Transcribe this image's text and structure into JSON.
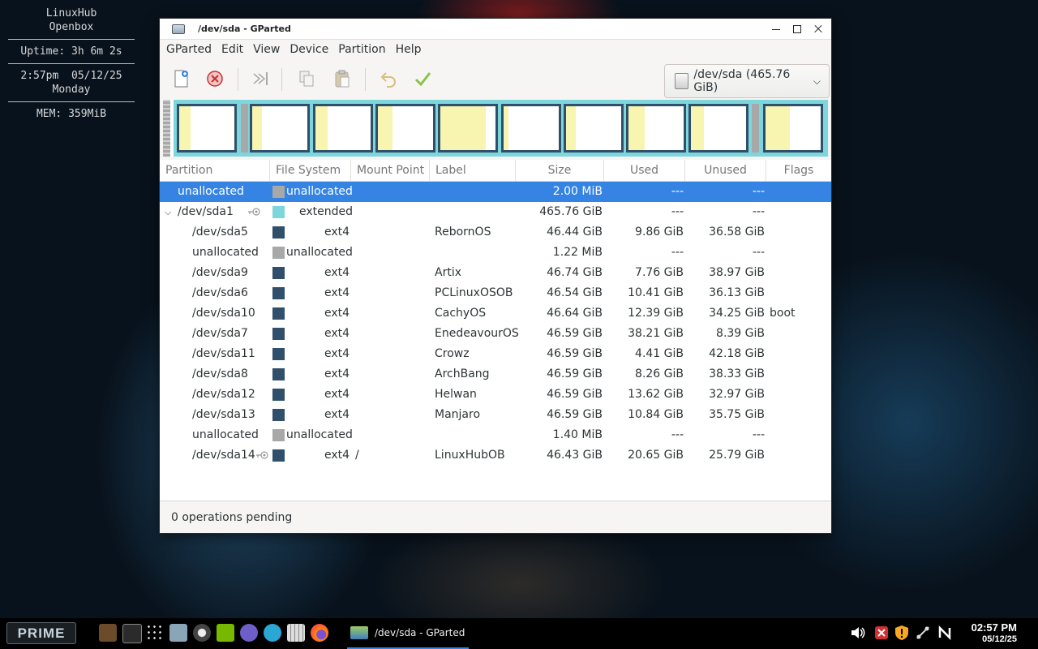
{
  "conky": {
    "hostname": "LinuxHub",
    "wm": "Openbox",
    "uptime": "Uptime: 3h 6m 2s",
    "time_date": "2:57pm  05/12/25",
    "weekday": "Monday",
    "mem": "MEM: 359MiB"
  },
  "window": {
    "title": "/dev/sda - GParted",
    "icon": "gparted-app-icon"
  },
  "menubar": [
    "GParted",
    "Edit",
    "View",
    "Device",
    "Partition",
    "Help"
  ],
  "toolbar": {
    "buttons": [
      "new-icon",
      "delete-icon",
      "resize-move-icon",
      "copy-icon",
      "paste-icon",
      "undo-icon",
      "apply-icon"
    ],
    "device_selector": "/dev/sda (465.76 GiB)"
  },
  "colors": {
    "unallocated": "#a8a8a8",
    "extended": "#7ed6dd",
    "ext4": "#2f4f6a",
    "used_fill": "#f7f5b0",
    "selection": "#3584e4"
  },
  "table": {
    "columns": [
      "Partition",
      "File System",
      "Mount Point",
      "Label",
      "Size",
      "Used",
      "Unused",
      "Flags"
    ],
    "rows": [
      {
        "partition": "unallocated",
        "fs": "unallocated",
        "mount": "",
        "label": "",
        "size": "2.00 MiB",
        "used": "---",
        "unused": "---",
        "flags": "",
        "level": 0,
        "selected": true
      },
      {
        "partition": "/dev/sda1",
        "fs": "extended",
        "mount": "",
        "label": "",
        "size": "465.76 GiB",
        "used": "---",
        "unused": "---",
        "flags": "",
        "level": 0,
        "expanded": true,
        "key": true
      },
      {
        "partition": "/dev/sda5",
        "fs": "ext4",
        "mount": "",
        "label": "RebornOS",
        "size": "46.44 GiB",
        "used": "9.86 GiB",
        "unused": "36.58 GiB",
        "flags": "",
        "level": 1
      },
      {
        "partition": "unallocated",
        "fs": "unallocated",
        "mount": "",
        "label": "",
        "size": "1.22 MiB",
        "used": "---",
        "unused": "---",
        "flags": "",
        "level": 1
      },
      {
        "partition": "/dev/sda9",
        "fs": "ext4",
        "mount": "",
        "label": "Artix",
        "size": "46.74 GiB",
        "used": "7.76 GiB",
        "unused": "38.97 GiB",
        "flags": "",
        "level": 1
      },
      {
        "partition": "/dev/sda6",
        "fs": "ext4",
        "mount": "",
        "label": "PCLinuxOSOB",
        "size": "46.54 GiB",
        "used": "10.41 GiB",
        "unused": "36.13 GiB",
        "flags": "",
        "level": 1
      },
      {
        "partition": "/dev/sda10",
        "fs": "ext4",
        "mount": "",
        "label": "CachyOS",
        "size": "46.64 GiB",
        "used": "12.39 GiB",
        "unused": "34.25 GiB",
        "flags": "boot",
        "level": 1
      },
      {
        "partition": "/dev/sda7",
        "fs": "ext4",
        "mount": "",
        "label": "EnedeavourOS",
        "size": "46.59 GiB",
        "used": "38.21 GiB",
        "unused": "8.39 GiB",
        "flags": "",
        "level": 1
      },
      {
        "partition": "/dev/sda11",
        "fs": "ext4",
        "mount": "",
        "label": "Crowz",
        "size": "46.59 GiB",
        "used": "4.41 GiB",
        "unused": "42.18 GiB",
        "flags": "",
        "level": 1
      },
      {
        "partition": "/dev/sda8",
        "fs": "ext4",
        "mount": "",
        "label": "ArchBang",
        "size": "46.59 GiB",
        "used": "8.26 GiB",
        "unused": "38.33 GiB",
        "flags": "",
        "level": 1
      },
      {
        "partition": "/dev/sda12",
        "fs": "ext4",
        "mount": "",
        "label": "Helwan",
        "size": "46.59 GiB",
        "used": "13.62 GiB",
        "unused": "32.97 GiB",
        "flags": "",
        "level": 1
      },
      {
        "partition": "/dev/sda13",
        "fs": "ext4",
        "mount": "",
        "label": "Manjaro",
        "size": "46.59 GiB",
        "used": "10.84 GiB",
        "unused": "35.75 GiB",
        "flags": "",
        "level": 1
      },
      {
        "partition": "unallocated",
        "fs": "unallocated",
        "mount": "",
        "label": "",
        "size": "1.40 MiB",
        "used": "---",
        "unused": "---",
        "flags": "",
        "level": 1
      },
      {
        "partition": "/dev/sda14",
        "fs": "ext4",
        "mount": "/",
        "label": "LinuxHubOB",
        "size": "46.43 GiB",
        "used": "20.65 GiB",
        "unused": "25.79 GiB",
        "flags": "",
        "level": 1,
        "key": true
      }
    ]
  },
  "diskmap": {
    "partitions": [
      {
        "name": "/dev/sda5",
        "used_fraction": 0.21
      },
      {
        "name": "/dev/sda9",
        "used_fraction": 0.17
      },
      {
        "name": "/dev/sda6",
        "used_fraction": 0.22
      },
      {
        "name": "/dev/sda10",
        "used_fraction": 0.27
      },
      {
        "name": "/dev/sda7",
        "used_fraction": 0.82
      },
      {
        "name": "/dev/sda11",
        "used_fraction": 0.09
      },
      {
        "name": "/dev/sda8",
        "used_fraction": 0.18
      },
      {
        "name": "/dev/sda12",
        "used_fraction": 0.29
      },
      {
        "name": "/dev/sda13",
        "used_fraction": 0.23
      },
      {
        "name": "/dev/sda14",
        "used_fraction": 0.44
      }
    ]
  },
  "statusbar": "0 operations pending",
  "taskbar": {
    "menu_button": "PRIME",
    "launchers": [
      "system-monitor-icon",
      "terminal-icon",
      "app-grid-icon",
      "file-manager-icon",
      "disk-utility-icon",
      "nvidia-icon",
      "updater-icon",
      "browser-icon",
      "calculator-icon",
      "firefox-icon"
    ],
    "active_task": "/dev/sda - GParted",
    "tray": [
      "volume-icon",
      "close-red-icon",
      "warning-shield-icon",
      "network-icon",
      "n-icon"
    ],
    "clock_time": "02:57 PM",
    "clock_date": "05/12/25"
  }
}
